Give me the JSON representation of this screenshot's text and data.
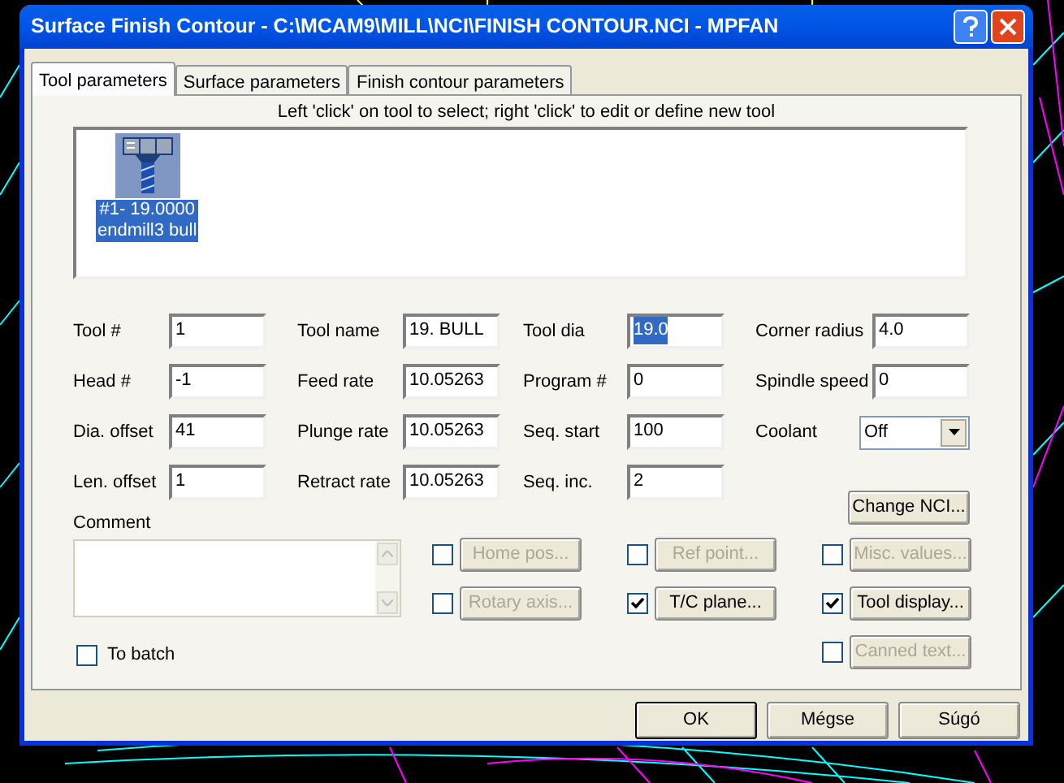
{
  "window": {
    "title": "Surface Finish Contour - C:\\MCAM9\\MILL\\NCI\\FINISH CONTOUR.NCI - MPFAN"
  },
  "tabs": [
    {
      "label": "Tool parameters",
      "selected": true
    },
    {
      "label": "Surface parameters",
      "selected": false
    },
    {
      "label": "Finish contour parameters",
      "selected": false
    }
  ],
  "tool_list": {
    "hint": "Left 'click' on tool to select; right 'click' to edit or define new tool",
    "tools": [
      {
        "number": "#1- 19.0000",
        "name": "endmill3 bull",
        "selected": true
      }
    ]
  },
  "field_columns": [
    [
      {
        "kind": "text",
        "label": "Tool #",
        "value": "1",
        "value_selected": false
      },
      {
        "kind": "text",
        "label": "Head #",
        "value": "-1",
        "value_selected": false
      },
      {
        "kind": "text",
        "label": "Dia. offset",
        "value": "41",
        "value_selected": false
      },
      {
        "kind": "text",
        "label": "Len. offset",
        "value": "1",
        "value_selected": false
      }
    ],
    [
      {
        "kind": "text",
        "label": "Tool name",
        "value": "19. BULL",
        "value_selected": false
      },
      {
        "kind": "text",
        "label": "Feed rate",
        "value": "10.05263",
        "value_selected": false
      },
      {
        "kind": "text",
        "label": "Plunge rate",
        "value": "10.05263",
        "value_selected": false
      },
      {
        "kind": "text",
        "label": "Retract rate",
        "value": "10.05263",
        "value_selected": false
      }
    ],
    [
      {
        "kind": "text",
        "label": "Tool dia",
        "value": "19.0",
        "value_selected": true
      },
      {
        "kind": "text",
        "label": "Program #",
        "value": "0",
        "value_selected": false
      },
      {
        "kind": "text",
        "label": "Seq. start",
        "value": "100",
        "value_selected": false
      },
      {
        "kind": "text",
        "label": "Seq. inc.",
        "value": "2",
        "value_selected": false
      }
    ],
    [
      {
        "kind": "text",
        "label": "Corner radius",
        "value": "4.0",
        "value_selected": false
      },
      {
        "kind": "text",
        "label": "Spindle speed",
        "value": "0",
        "value_selected": false
      },
      {
        "kind": "dropdown",
        "label": "Coolant",
        "value": "Off",
        "value_selected": false
      }
    ]
  ],
  "change_nci_button": "Change NCI...",
  "comment": {
    "label": "Comment"
  },
  "to_batch": {
    "label": "To batch",
    "checked": false
  },
  "options": [
    {
      "label": "Home pos...",
      "checked": false,
      "disabled": true
    },
    {
      "label": "Ref point...",
      "checked": false,
      "disabled": true
    },
    {
      "label": "Misc. values...",
      "checked": false,
      "disabled": true
    },
    {
      "label": "Rotary axis...",
      "checked": false,
      "disabled": true
    },
    {
      "label": "T/C plane...",
      "checked": true,
      "disabled": false
    },
    {
      "label": "Tool display...",
      "checked": true,
      "disabled": false
    },
    {
      "label": "Canned text...",
      "checked": false,
      "disabled": true
    }
  ],
  "buttons": [
    {
      "label": "OK",
      "default": true
    },
    {
      "label": "Mégse",
      "default": false
    },
    {
      "label": "Súgó",
      "default": false
    }
  ]
}
